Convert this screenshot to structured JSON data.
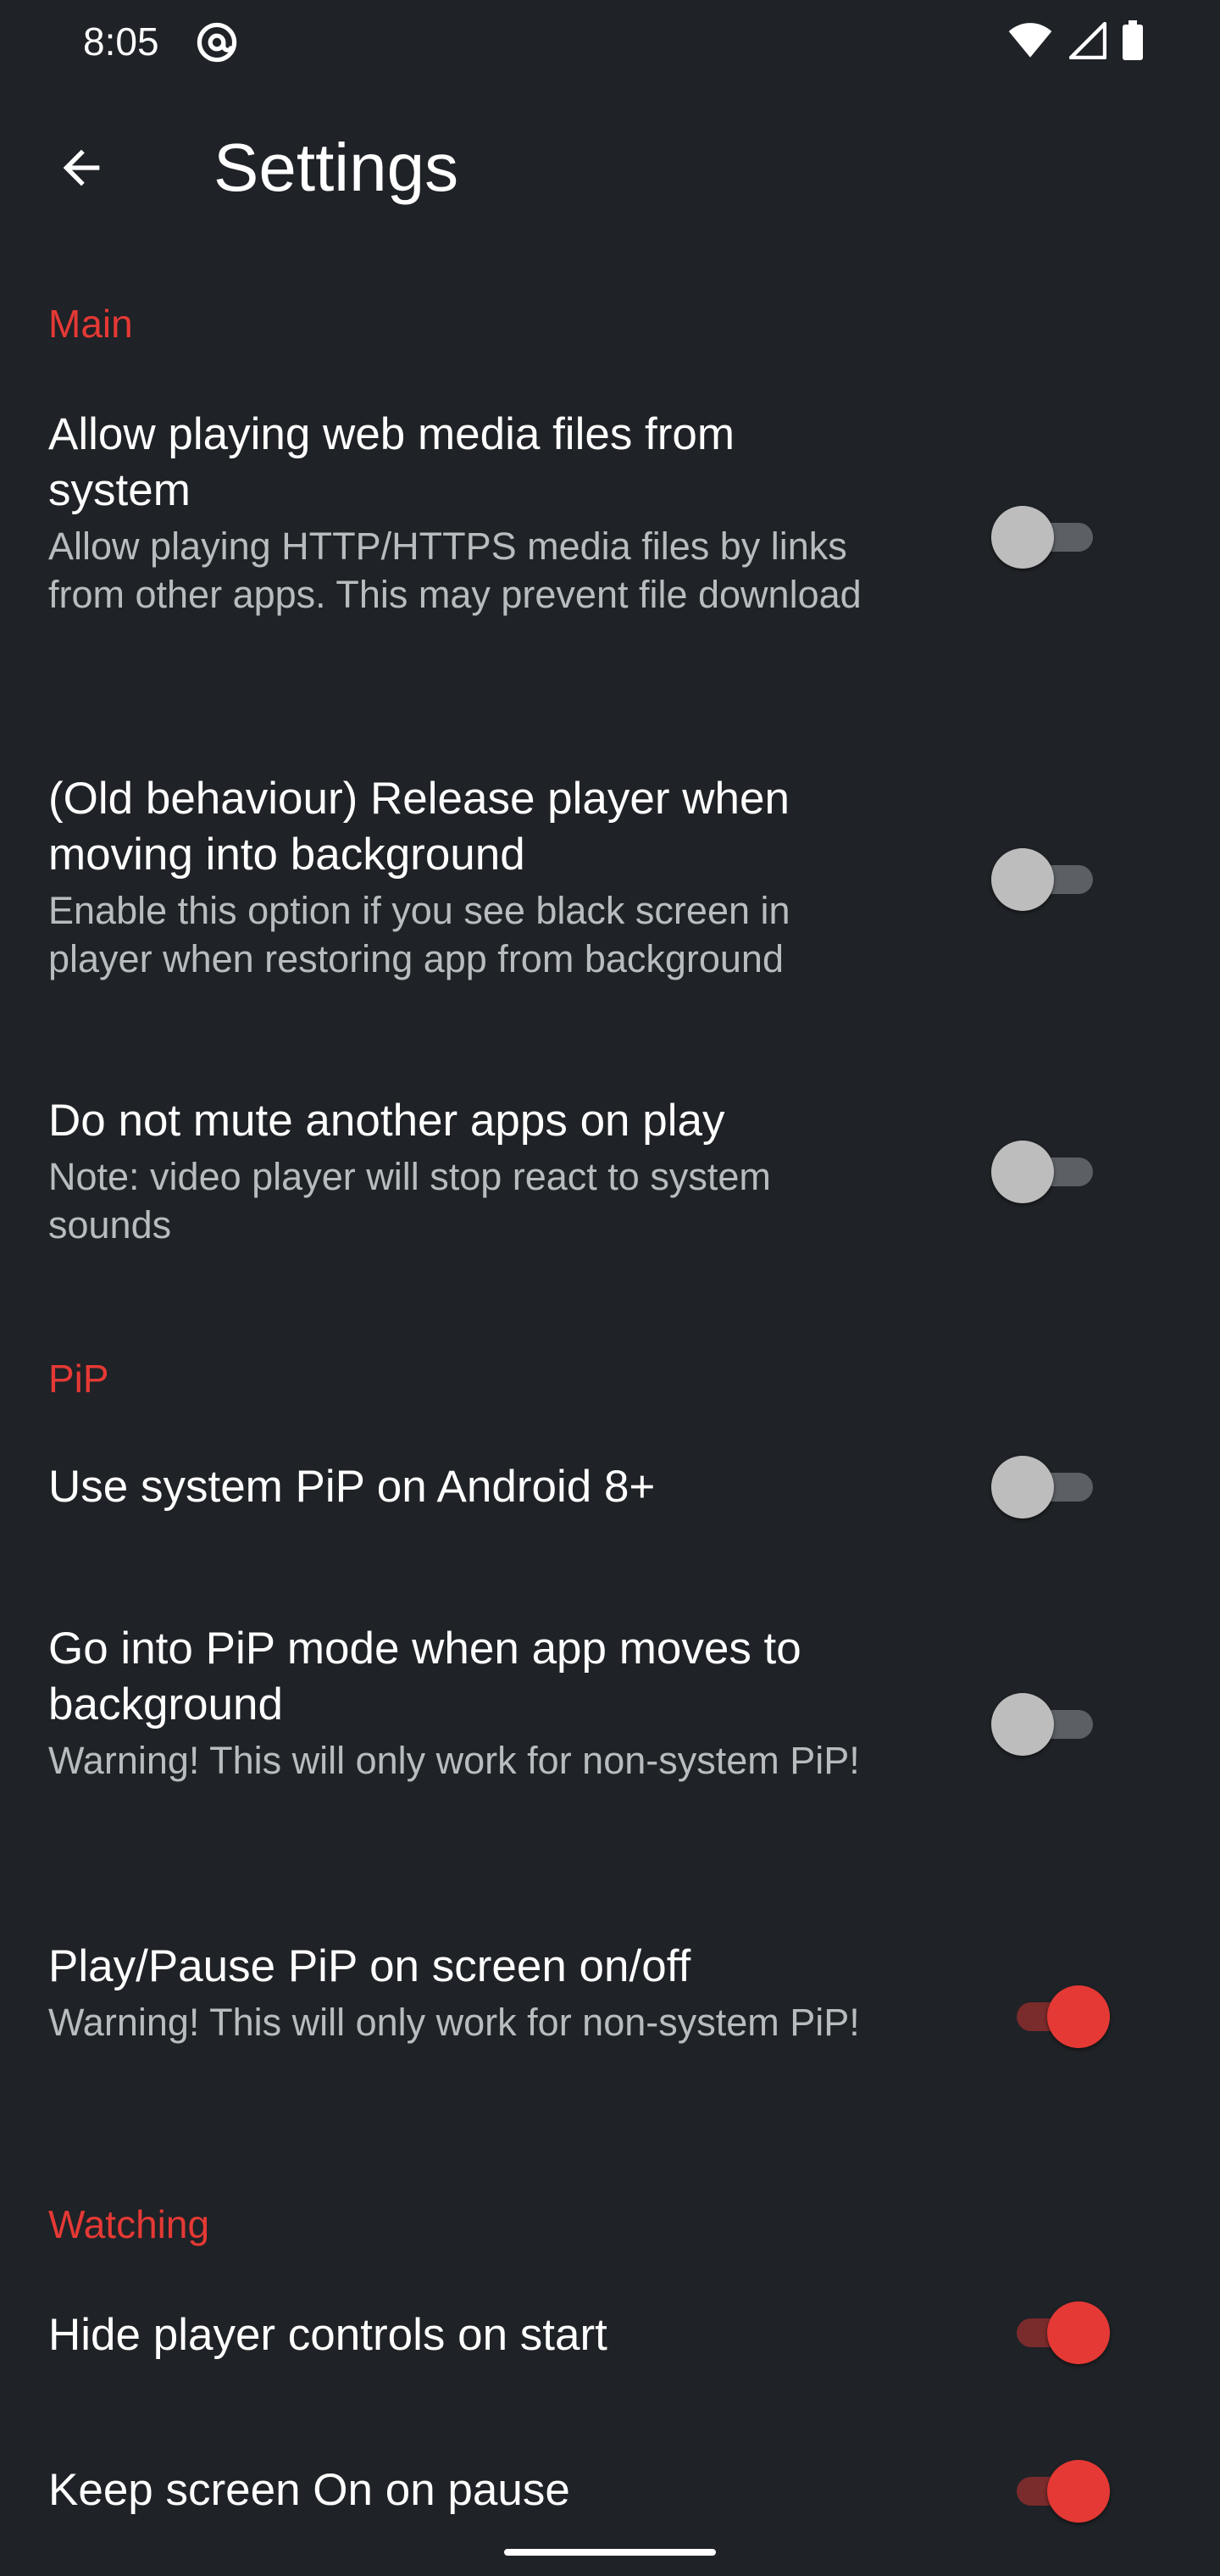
{
  "status_bar": {
    "time": "8:05",
    "icons": [
      "at-sign-icon",
      "wifi-icon",
      "signal-icon",
      "battery-icon"
    ]
  },
  "app_bar": {
    "title": "Settings",
    "back_icon": "arrow-back-icon"
  },
  "colors": {
    "accent": "#e53935",
    "background": "#1f2226",
    "switch_off_thumb": "#bdbdbd",
    "switch_off_track": "#5c5f63"
  },
  "sections": {
    "main": {
      "header": "Main",
      "items": [
        {
          "title": "Allow playing web media files from system",
          "summary": "Allow playing HTTP/HTTPS media files by links from other apps. This may prevent file download",
          "checked": false
        },
        {
          "title": "(Old behaviour) Release player when moving into background",
          "summary": "Enable this option if you see black screen in player when restoring app from background",
          "checked": false
        },
        {
          "title": "Do not mute another apps on play",
          "summary": "Note: video player will stop react to system sounds",
          "checked": false
        }
      ]
    },
    "pip": {
      "header": "PiP",
      "items": [
        {
          "title": "Use system PiP on Android 8+",
          "checked": false
        },
        {
          "title": "Go into PiP mode when app moves to background",
          "summary": "Warning! This will only work for non-system PiP!",
          "checked": false
        },
        {
          "title": "Play/Pause PiP on screen on/off",
          "summary": "Warning! This will only work for non-system PiP!",
          "checked": true
        }
      ]
    },
    "watching": {
      "header": "Watching",
      "items": [
        {
          "title": "Hide player controls on start",
          "checked": true
        },
        {
          "title": "Keep screen On on pause",
          "checked": true
        }
      ]
    }
  }
}
